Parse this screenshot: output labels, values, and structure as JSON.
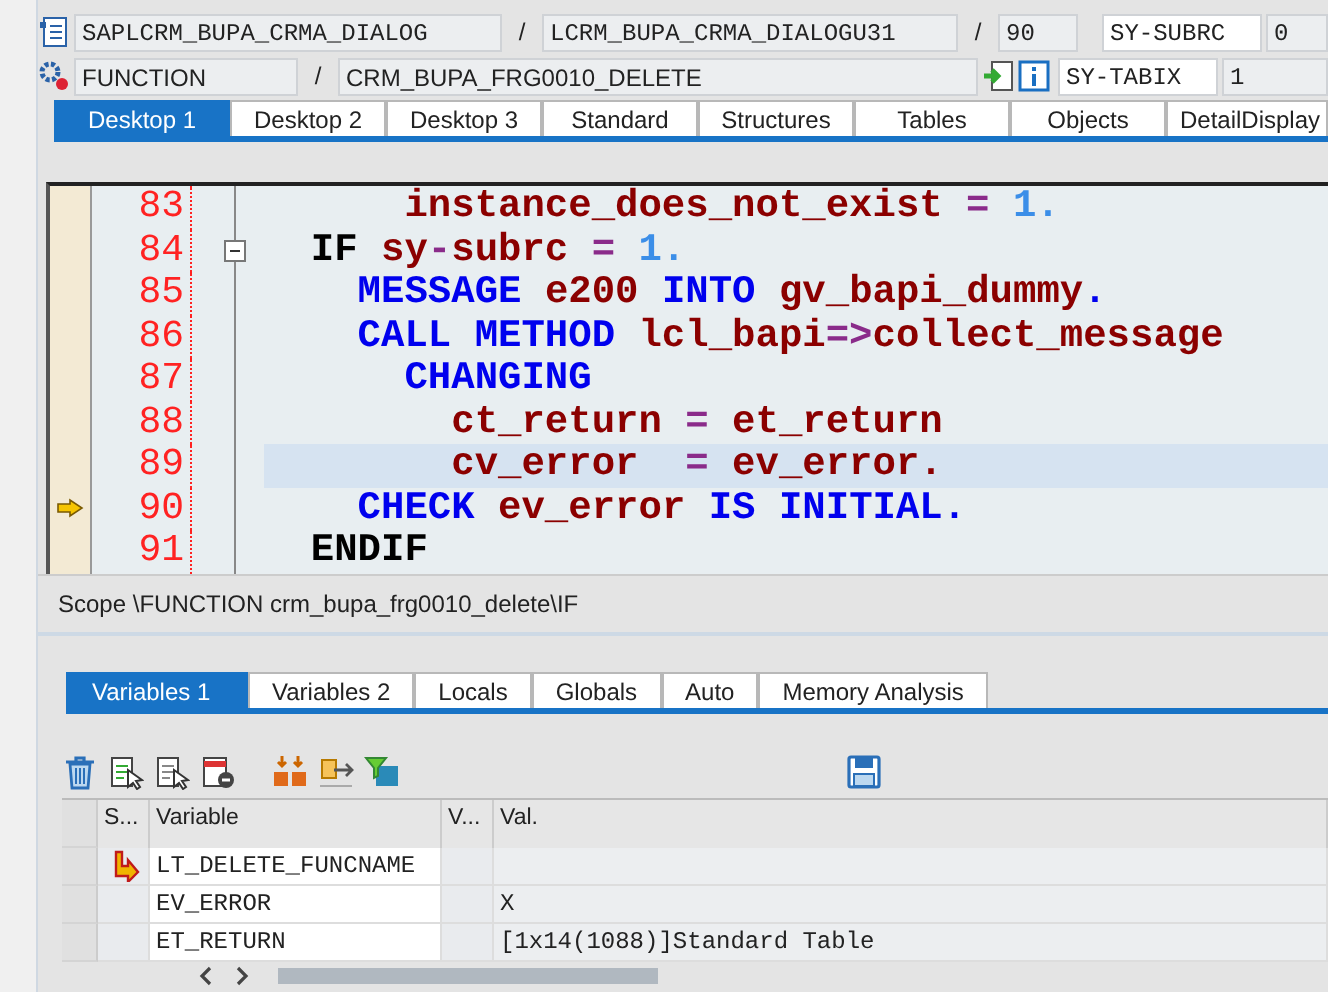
{
  "header": {
    "program": "SAPLCRM_BUPA_CRMA_DIALOG",
    "include": "LCRM_BUPA_CRMA_DIALOGU31",
    "line": "90",
    "event_type": "FUNCTION",
    "event": "CRM_BUPA_FRG0010_DELETE",
    "separators": [
      "/",
      "/",
      "/"
    ],
    "sys_fields": [
      {
        "name": "SY-SUBRC",
        "value": "0"
      },
      {
        "name": "SY-TABIX",
        "value": "1"
      }
    ]
  },
  "desktop_tabs": [
    {
      "label": "Desktop 1",
      "selected": true
    },
    {
      "label": "Desktop 2",
      "selected": false
    },
    {
      "label": "Desktop 3",
      "selected": false
    },
    {
      "label": "Standard",
      "selected": false
    },
    {
      "label": "Structures",
      "selected": false
    },
    {
      "label": "Tables",
      "selected": false
    },
    {
      "label": "Objects",
      "selected": false
    },
    {
      "label": "DetailDisplay",
      "selected": false
    }
  ],
  "code_lines": [
    {
      "number": "83",
      "fold": false,
      "current": false,
      "highlighted": false,
      "tokens": [
        {
          "kind": "id",
          "text": "      instance_does_not_exist"
        },
        {
          "kind": "op",
          "text": " = "
        },
        {
          "kind": "num",
          "text": "1."
        }
      ]
    },
    {
      "number": "84",
      "fold": true,
      "current": false,
      "highlighted": false,
      "tokens": [
        {
          "kind": "ctl",
          "text": "  IF "
        },
        {
          "kind": "id",
          "text": "sy"
        },
        {
          "kind": "op",
          "text": "-"
        },
        {
          "kind": "id",
          "text": "subrc"
        },
        {
          "kind": "op",
          "text": " = "
        },
        {
          "kind": "num",
          "text": "1."
        }
      ]
    },
    {
      "number": "85",
      "fold": false,
      "current": false,
      "highlighted": false,
      "tokens": [
        {
          "kind": "kw",
          "text": "    MESSAGE "
        },
        {
          "kind": "id",
          "text": "e200 "
        },
        {
          "kind": "kw",
          "text": "INTO "
        },
        {
          "kind": "id",
          "text": "gv_bapi_dummy"
        },
        {
          "kind": "kw",
          "text": "."
        }
      ]
    },
    {
      "number": "86",
      "fold": false,
      "current": false,
      "highlighted": false,
      "tokens": [
        {
          "kind": "kw",
          "text": "    CALL METHOD "
        },
        {
          "kind": "id",
          "text": "lcl_bapi"
        },
        {
          "kind": "op",
          "text": "=>"
        },
        {
          "kind": "id",
          "text": "collect_message"
        }
      ]
    },
    {
      "number": "87",
      "fold": false,
      "current": false,
      "highlighted": false,
      "tokens": [
        {
          "kind": "kw",
          "text": "      CHANGING"
        }
      ]
    },
    {
      "number": "88",
      "fold": false,
      "current": false,
      "highlighted": false,
      "tokens": [
        {
          "kind": "id",
          "text": "        ct_return"
        },
        {
          "kind": "op",
          "text": " = "
        },
        {
          "kind": "id",
          "text": "et_return"
        }
      ]
    },
    {
      "number": "89",
      "fold": false,
      "current": false,
      "highlighted": true,
      "tokens": [
        {
          "kind": "id",
          "text": "        cv_error  "
        },
        {
          "kind": "op",
          "text": "= "
        },
        {
          "kind": "id",
          "text": "ev_error."
        }
      ]
    },
    {
      "number": "90",
      "fold": false,
      "current": true,
      "highlighted": false,
      "tokens": [
        {
          "kind": "kw",
          "text": "    CHECK "
        },
        {
          "kind": "id",
          "text": "ev_error "
        },
        {
          "kind": "kw",
          "text": "IS INITIAL."
        }
      ]
    },
    {
      "number": "91",
      "fold": false,
      "current": false,
      "highlighted": false,
      "tokens": [
        {
          "kind": "ctl",
          "text": "  ENDIF"
        }
      ]
    }
  ],
  "scope": "Scope \\FUNCTION crm_bupa_frg0010_delete\\IF",
  "variable_tabs": [
    {
      "label": "Variables 1",
      "selected": true
    },
    {
      "label": "Variables 2",
      "selected": false
    },
    {
      "label": "Locals",
      "selected": false
    },
    {
      "label": "Globals",
      "selected": false
    },
    {
      "label": "Auto",
      "selected": false
    },
    {
      "label": "Memory Analysis",
      "selected": false
    }
  ],
  "table": {
    "columns": [
      "S...",
      "Variable",
      "V...",
      "Val."
    ],
    "rows": [
      {
        "status_icon": true,
        "variable": "LT_DELETE_FUNCNAME",
        "value": ""
      },
      {
        "status_icon": false,
        "variable": "EV_ERROR",
        "value": "X"
      },
      {
        "status_icon": false,
        "variable": "ET_RETURN",
        "value": "[1x14(1088)]Standard Table"
      }
    ]
  }
}
